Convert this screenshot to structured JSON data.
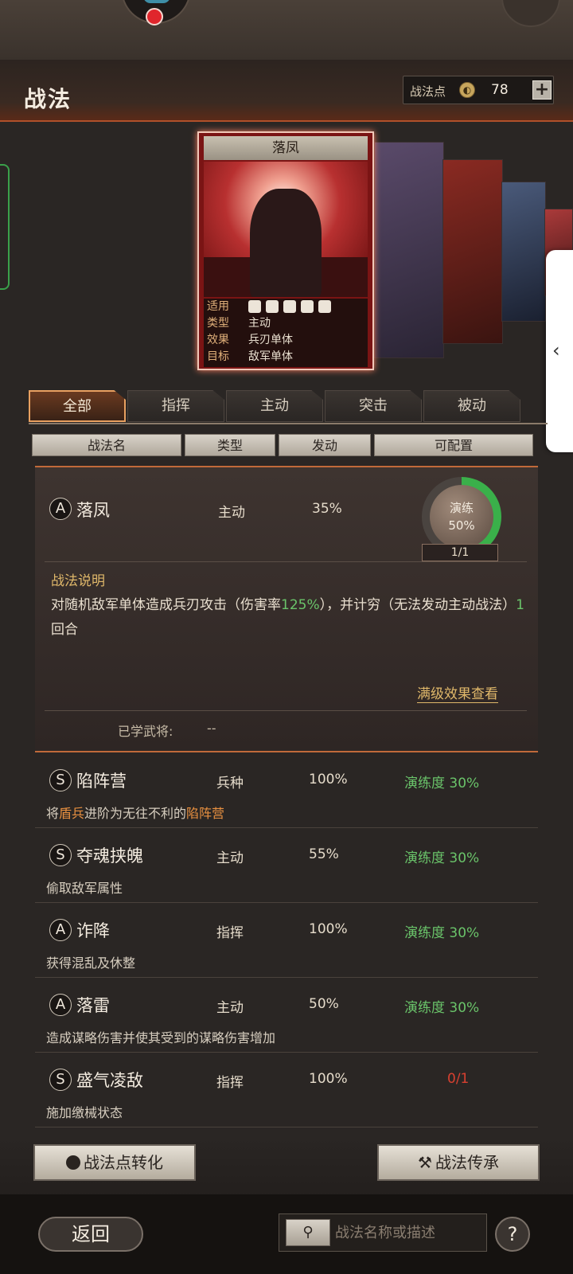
{
  "header": {
    "title": "战法",
    "points_label": "战法点",
    "points_value": "78",
    "plus": "+"
  },
  "card": {
    "name": "落凤",
    "rows": [
      {
        "k": "适用",
        "v": ""
      },
      {
        "k": "类型",
        "v": "主动"
      },
      {
        "k": "效果",
        "v": "兵刃单体"
      },
      {
        "k": "目标",
        "v": "敌军单体"
      }
    ],
    "applicable_icons": [
      "cavalry-icon",
      "shield-icon",
      "bow-icon",
      "spear-icon",
      "wheel-icon"
    ]
  },
  "tabs": [
    "全部",
    "指挥",
    "主动",
    "突击",
    "被动"
  ],
  "columns": [
    "战法名",
    "类型",
    "发动",
    "可配置"
  ],
  "expanded": {
    "grade": "A",
    "name": "落凤",
    "type": "主动",
    "rate": "35%",
    "training_label": "演练",
    "training_progress": "50%",
    "training_fraction": 0.5,
    "configurable": "1/1",
    "desc_title": "战法说明",
    "desc_pre": "对随机敌军单体造成兵刃攻击（伤害率",
    "desc_hl1": "125%",
    "desc_mid": "），并计穷（无法发动主动战法）",
    "desc_hl2": "1",
    "desc_post": "回合",
    "full_level_link": "满级效果查看",
    "learned_label": "已学武将:",
    "learned_value": "--"
  },
  "list": [
    {
      "grade": "S",
      "name": "陷阵营",
      "type": "兵种",
      "rate": "100%",
      "progress": "演练度 30%",
      "desc_pre": "将",
      "desc_o1": "盾兵",
      "desc_mid": "进阶为无往不利的",
      "desc_o2": "陷阵营"
    },
    {
      "grade": "S",
      "name": "夺魂挟魄",
      "type": "主动",
      "rate": "55%",
      "progress": "演练度 30%",
      "desc": "偷取敌军属性"
    },
    {
      "grade": "A",
      "name": "诈降",
      "type": "指挥",
      "rate": "100%",
      "progress": "演练度 30%",
      "desc": "获得混乱及休整"
    },
    {
      "grade": "A",
      "name": "落雷",
      "type": "主动",
      "rate": "50%",
      "progress": "演练度 30%",
      "desc": "造成谋略伤害并使其受到的谋略伤害增加"
    },
    {
      "grade": "S",
      "name": "盛气凌敌",
      "type": "指挥",
      "rate": "100%",
      "progress": "0/1",
      "desc": "施加缴械状态"
    }
  ],
  "bottom": {
    "convert": "战法点转化",
    "inherit": "战法传承",
    "back": "返回",
    "search_placeholder": "战法名称或描述",
    "help": "?"
  }
}
